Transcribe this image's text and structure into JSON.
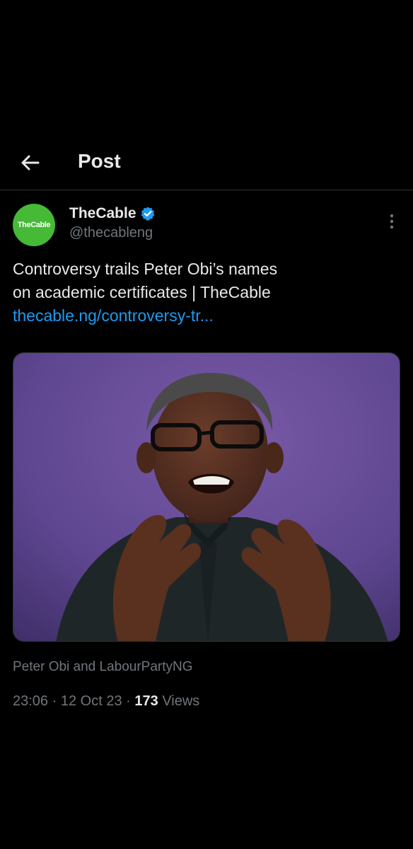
{
  "header": {
    "title": "Post",
    "back_icon": "arrow-left-icon"
  },
  "author": {
    "display_name": "TheCable",
    "handle": "@thecableng",
    "avatar_text": "TheCable",
    "verified": true,
    "avatar_color": "#46b937",
    "verified_color": "#1d9bf0"
  },
  "tweet": {
    "text_line_1": "Controversy trails Peter Obi’s names",
    "text_line_2": "on academic certificates | TheCable",
    "link_text": "thecable.ng/controversy-tr...",
    "link_color": "#1d9bf0"
  },
  "media_tags": "Peter Obi and LabourPartyNG",
  "meta": {
    "time": "23:06",
    "date": "12 Oct 23",
    "views_count": "173",
    "views_label": "Views",
    "separator": "·"
  }
}
